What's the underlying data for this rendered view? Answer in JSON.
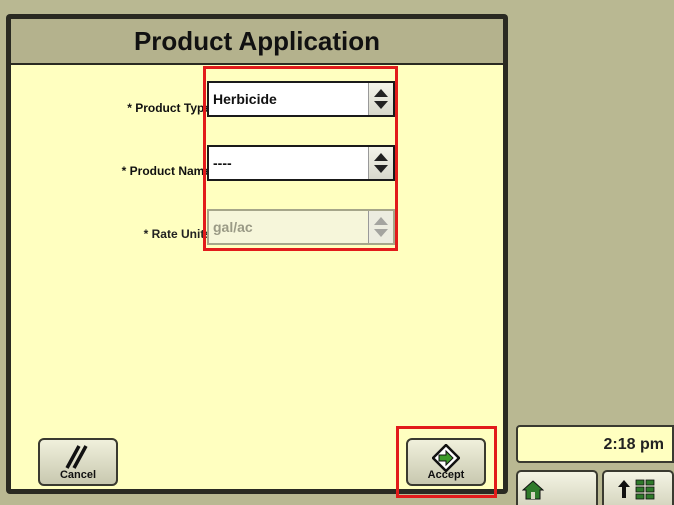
{
  "dialog": {
    "title": "Product Application",
    "fields": [
      {
        "label": "* Product Type",
        "value": "Herbicide",
        "enabled": true
      },
      {
        "label": "* Product Name",
        "value": "----",
        "enabled": true
      },
      {
        "label": "* Rate Units",
        "value": "gal/ac",
        "enabled": false
      }
    ],
    "cancel_label": "Cancel",
    "cancel_icon": "cancel-slashes-icon",
    "accept_label": "Accept",
    "accept_icon": "accept-arrow-icon"
  },
  "status": {
    "time": "2:18 pm"
  },
  "nav": {
    "home_icon": "home-icon",
    "layout_icon": "up-arrow-grid-icon"
  },
  "colors": {
    "background": "#b9b892",
    "dialog_fill": "#ffffc0",
    "title_bar": "#b4b28d",
    "highlight": "#e21b1b"
  }
}
